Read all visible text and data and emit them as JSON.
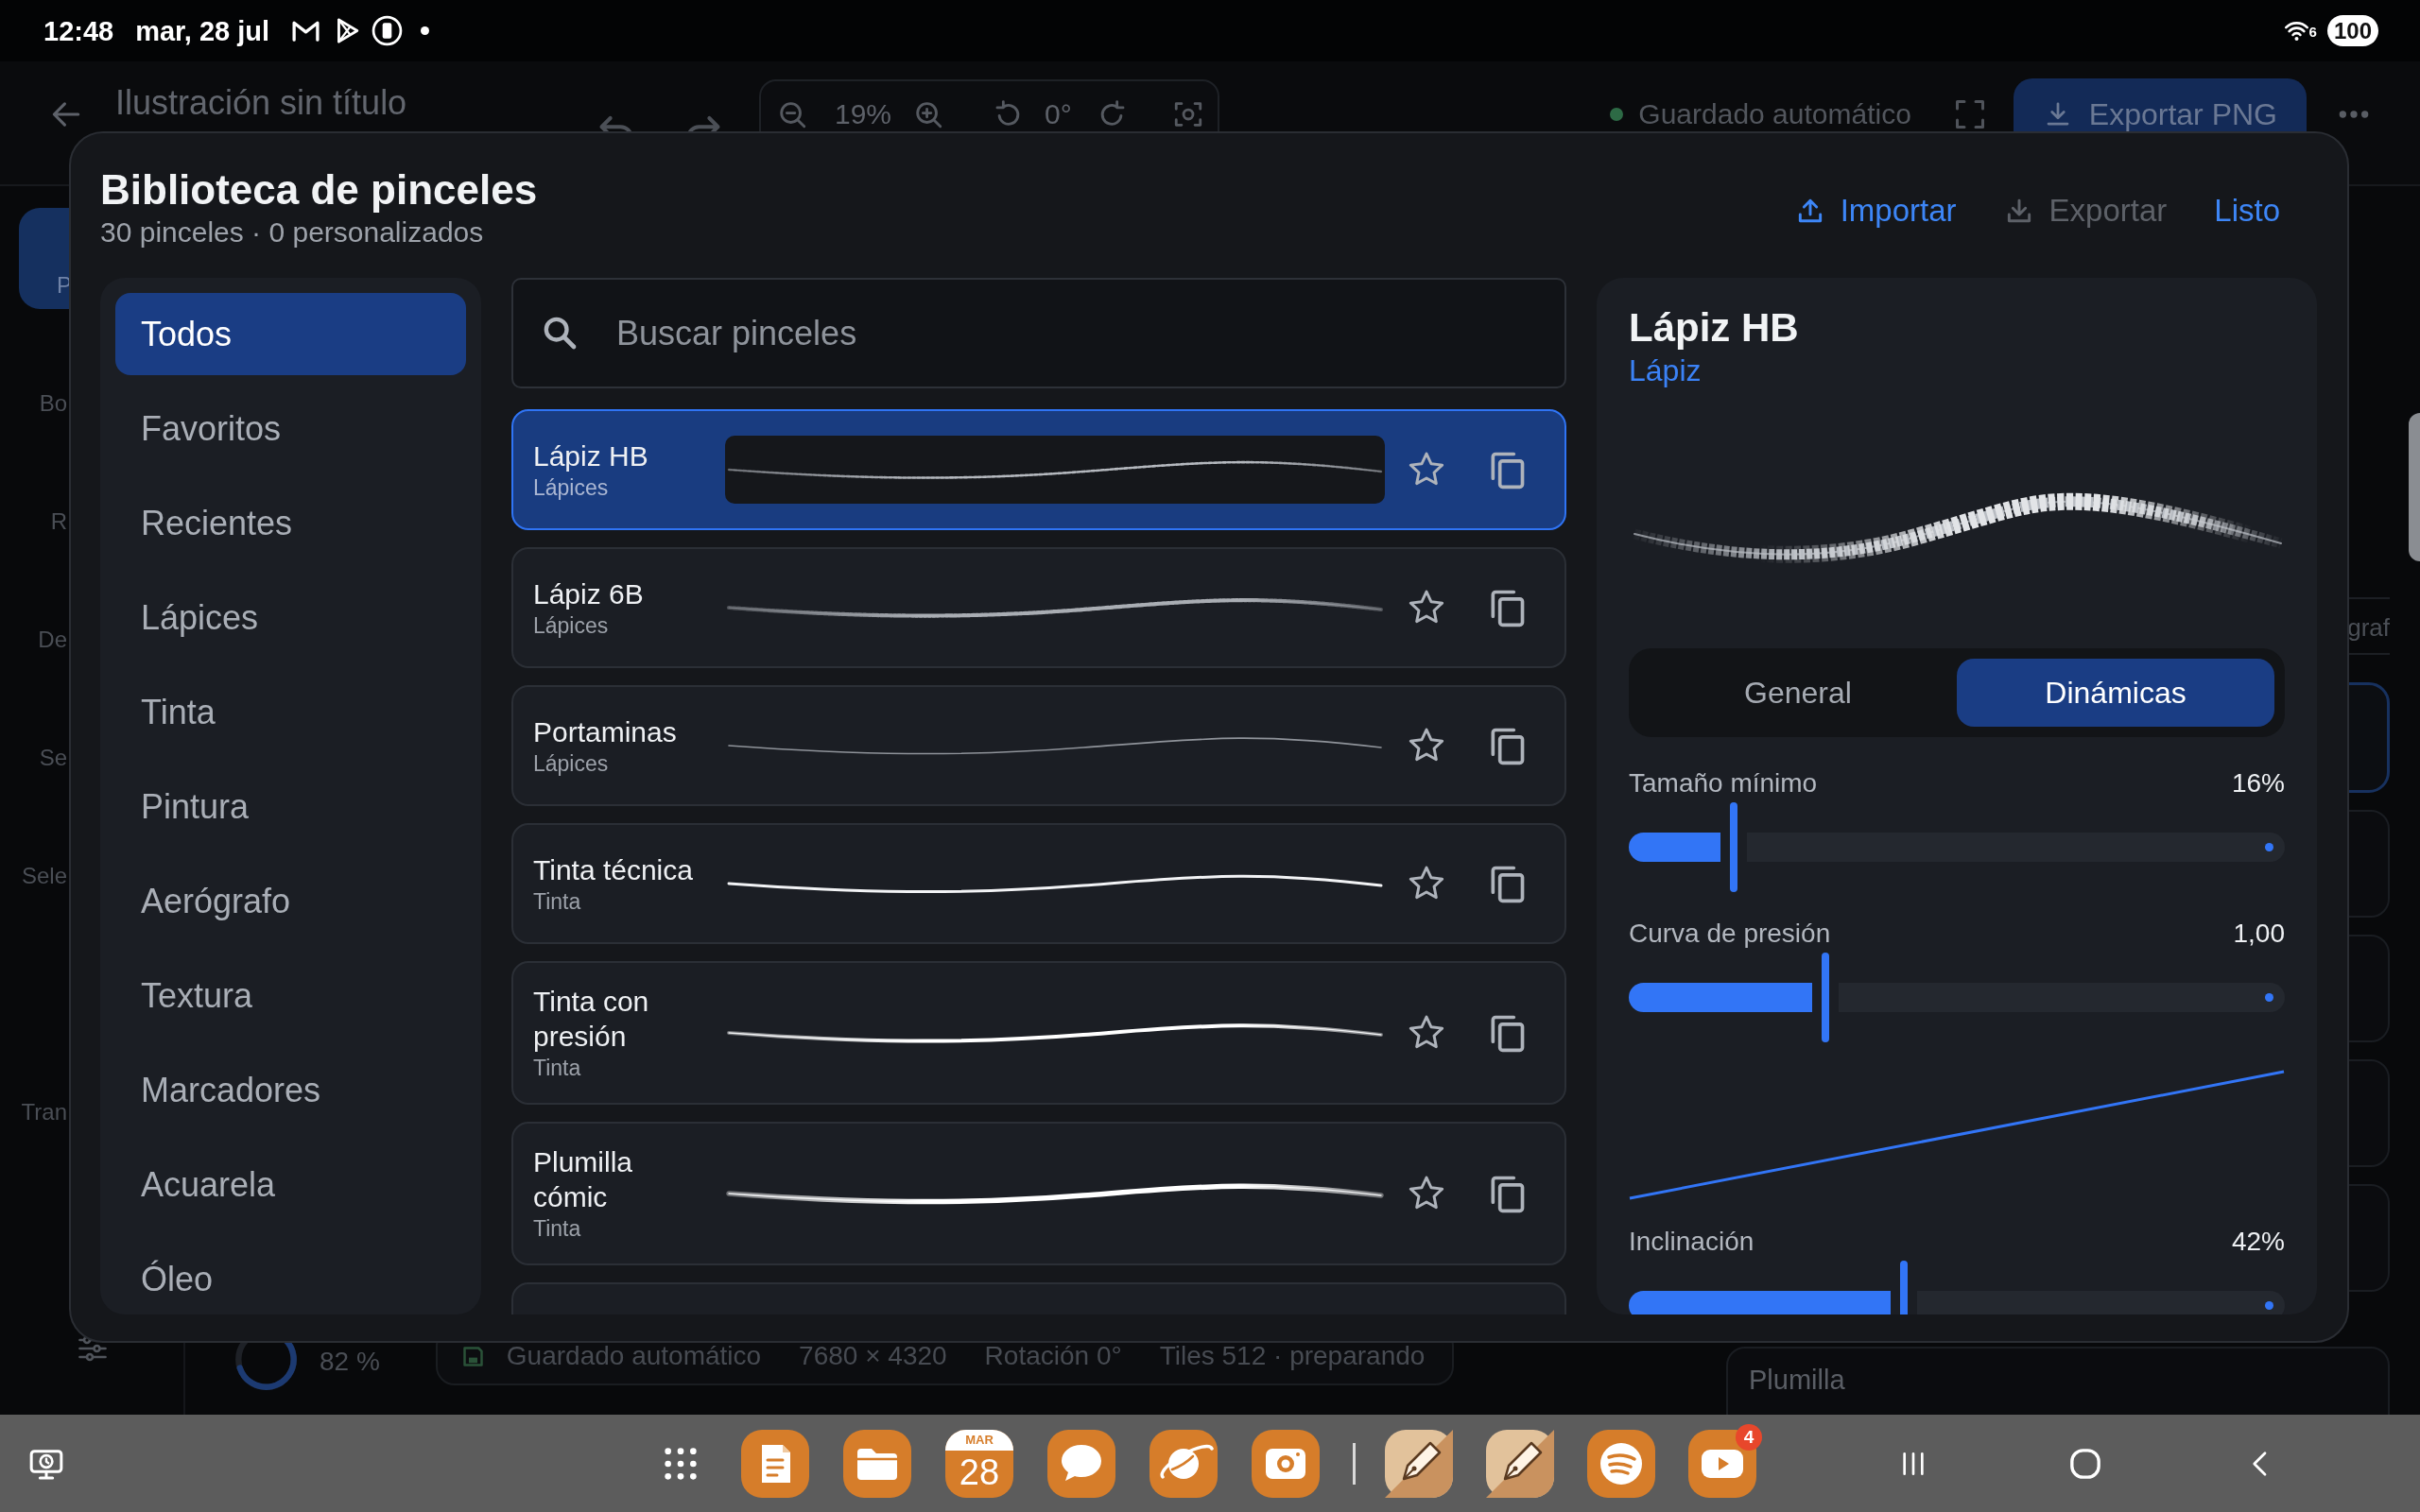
{
  "status_bar": {
    "time": "12:48",
    "date": "mar, 28 jul",
    "wifi_label": "6",
    "battery": "100"
  },
  "app": {
    "title": "Ilustración sin título",
    "zoom": "19%",
    "rotation": "0°",
    "autosave": "Guardado automático",
    "export_button": "Exportar PNG",
    "tool_groups": [
      [
        {
          "label": "P",
          "selected": true
        },
        {
          "label": "Bo",
          "selected": false
        },
        {
          "label": "R",
          "selected": false
        },
        {
          "label": "De",
          "selected": false
        },
        {
          "label": "Se",
          "selected": false
        },
        {
          "label": "Sele",
          "selected": false
        }
      ],
      [
        {
          "label": "Tran",
          "selected": false
        }
      ]
    ],
    "status": {
      "zoom": "82 %",
      "items": [
        "Guardado automático",
        "7680 × 4320",
        "Rotación 0°",
        "Tiles 512 · preparando"
      ]
    },
    "side_panel": {
      "tab": "graf",
      "card_title": "Plumilla"
    }
  },
  "dialog": {
    "title": "Biblioteca de pinceles",
    "subtitle": "30 pinceles · 0 personalizados",
    "actions": [
      {
        "label": "Importar",
        "kind": "import",
        "disabled": false
      },
      {
        "label": "Exportar",
        "kind": "export",
        "disabled": true
      },
      {
        "label": "Listo",
        "kind": "done",
        "disabled": false
      }
    ],
    "categories": [
      {
        "label": "Todos",
        "selected": true
      },
      {
        "label": "Favoritos",
        "selected": false
      },
      {
        "label": "Recientes",
        "selected": false
      },
      {
        "label": "Lápices",
        "selected": false
      },
      {
        "label": "Tinta",
        "selected": false
      },
      {
        "label": "Pintura",
        "selected": false
      },
      {
        "label": "Aerógrafo",
        "selected": false
      },
      {
        "label": "Textura",
        "selected": false
      },
      {
        "label": "Marcadores",
        "selected": false
      },
      {
        "label": "Acuarela",
        "selected": false
      },
      {
        "label": "Óleo",
        "selected": false
      }
    ],
    "search": {
      "placeholder": "Buscar pinceles"
    },
    "brushes": [
      {
        "name": "Lápiz HB",
        "category": "Lápices",
        "kind": "pencil-hard",
        "selected": true,
        "favorite": false
      },
      {
        "name": "Lápiz 6B",
        "category": "Lápices",
        "kind": "pencil-soft",
        "selected": false,
        "favorite": false
      },
      {
        "name": "Portaminas",
        "category": "Lápices",
        "kind": "mechanical",
        "selected": false,
        "favorite": false
      },
      {
        "name": "Tinta técnica",
        "category": "Tinta",
        "kind": "ink-fine",
        "selected": false,
        "favorite": false
      },
      {
        "name": "Tinta con presión",
        "category": "Tinta",
        "kind": "ink-pressure",
        "selected": false,
        "favorite": false
      },
      {
        "name": "Plumilla cómic",
        "category": "Tinta",
        "kind": "nib",
        "selected": false,
        "favorite": false
      }
    ],
    "detail": {
      "name": "Lápiz HB",
      "type": "Lápiz",
      "tabs": [
        {
          "label": "General",
          "selected": false
        },
        {
          "label": "Dinámicas",
          "selected": true
        }
      ],
      "sliders": [
        {
          "label": "Tamaño mínimo",
          "value": "16%",
          "level": 0.16,
          "kind": "plain"
        },
        {
          "label": "Curva de presión",
          "value": "1,00",
          "level": 0.3,
          "kind": "curve"
        },
        {
          "label": "Inclinación",
          "value": "42%",
          "level": 0.42,
          "kind": "plain"
        }
      ]
    }
  },
  "taskbar": {
    "pinned": [
      {
        "kind": "notes"
      },
      {
        "kind": "folder"
      },
      {
        "kind": "calendar",
        "month": "MAR",
        "day": "28"
      },
      {
        "kind": "chat"
      },
      {
        "kind": "planet"
      },
      {
        "kind": "camera"
      }
    ],
    "recent": [
      {
        "kind": "pen"
      },
      {
        "kind": "pen"
      },
      {
        "kind": "waves"
      },
      {
        "kind": "video",
        "badge": "4"
      }
    ]
  }
}
